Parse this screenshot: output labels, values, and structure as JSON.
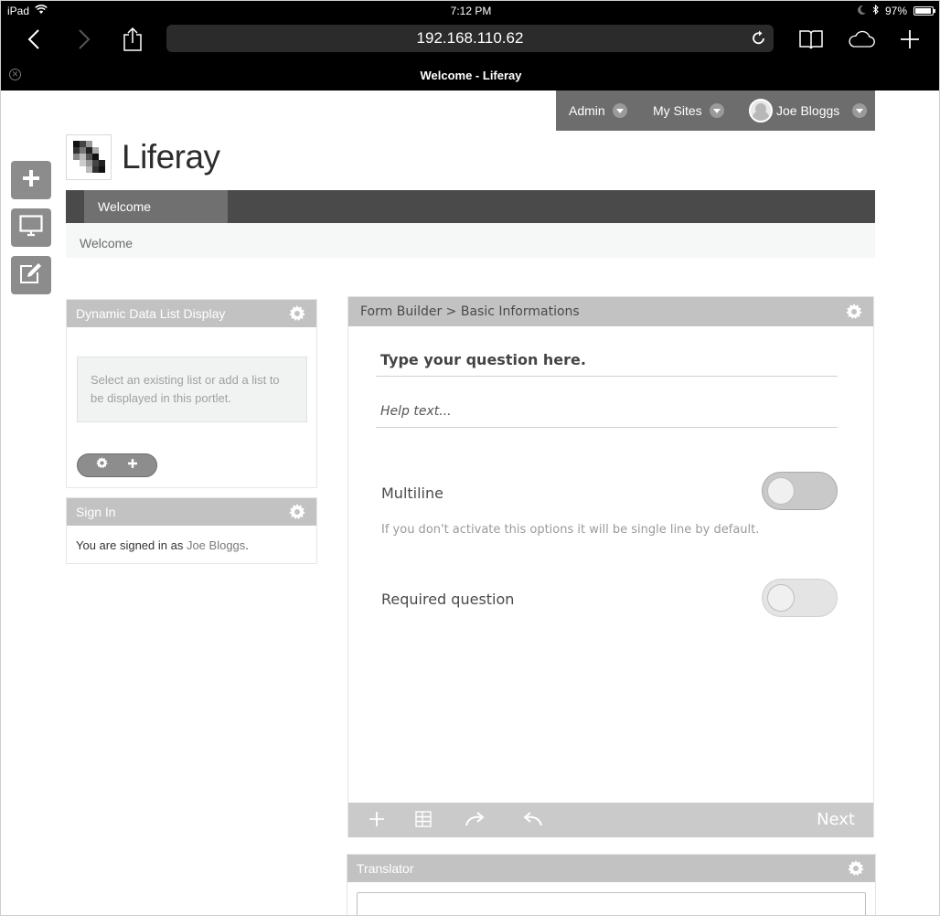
{
  "status_bar": {
    "device": "iPad",
    "time": "7:12 PM",
    "battery": "97%"
  },
  "browser": {
    "url": "192.168.110.62",
    "tab_title": "Welcome - Liferay"
  },
  "dockbar": {
    "items": [
      {
        "label": "Admin"
      },
      {
        "label": "My Sites"
      },
      {
        "label": "Joe Bloggs"
      }
    ]
  },
  "site": {
    "name": "Liferay"
  },
  "nav": {
    "items": [
      {
        "label": "Welcome"
      }
    ]
  },
  "breadcrumb": {
    "current": "Welcome"
  },
  "ddl_portlet": {
    "title": "Dynamic Data List Display",
    "message": "Select an existing list or add a list to be displayed in this portlet."
  },
  "signin_portlet": {
    "title": "Sign In",
    "text_prefix": "You are signed in as ",
    "user_link": "Joe Bloggs",
    "text_suffix": "."
  },
  "form_portlet": {
    "title": "Form Builder > Basic Informations",
    "question_placeholder": "Type your question here.",
    "help_placeholder": "Help text...",
    "multiline": {
      "label": "Multiline",
      "help": "If you don't activate this options it will be single line by default.",
      "on": false
    },
    "required": {
      "label": "Required question",
      "on": false
    },
    "footer": {
      "next_label": "Next"
    }
  },
  "translator_portlet": {
    "title": "Translator"
  },
  "colors": {
    "dockbar": "#6d6d6d",
    "navbar": "#4a4a4a",
    "portlet_header": "#c2c2c2",
    "toggle_track": "#c9c9c9"
  }
}
